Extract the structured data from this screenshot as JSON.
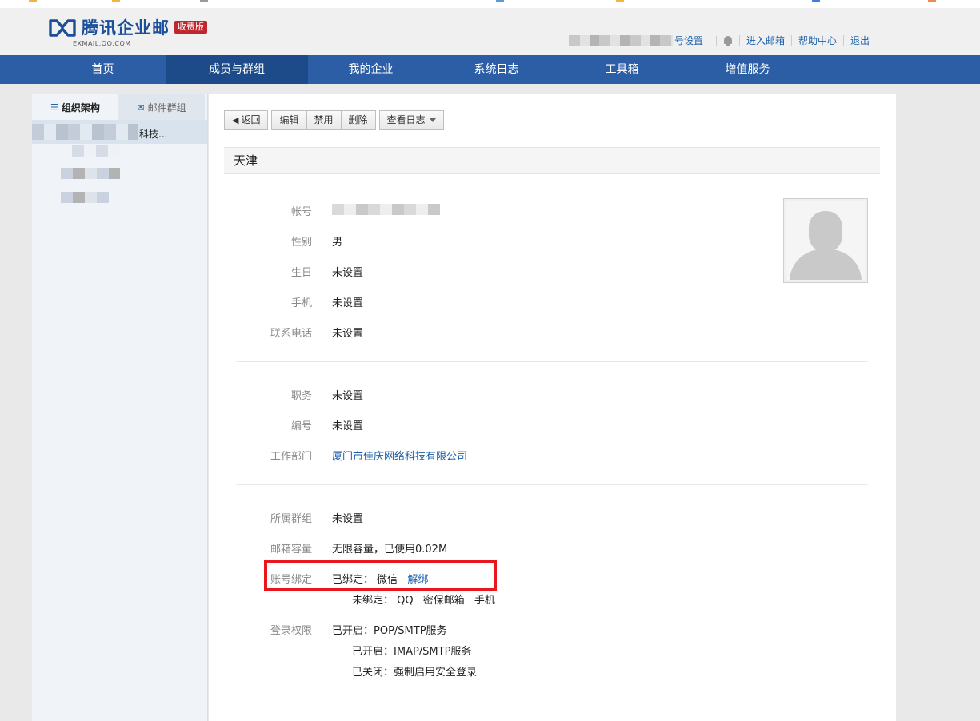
{
  "brand": {
    "name": "腾讯企业邮",
    "badge": "收费版",
    "domain": "EXMAIL.QQ.COM",
    "color": "#1b4f99"
  },
  "toplinks": {
    "account_settings": "号设置",
    "enter_mailbox": "进入邮箱",
    "help_center": "帮助中心",
    "logout": "退出"
  },
  "nav": {
    "tabs": [
      "首页",
      "成员与群组",
      "我的企业",
      "系统日志",
      "工具箱",
      "增值服务"
    ],
    "active_index": 1,
    "color": "#2c5ea5"
  },
  "sidebar": {
    "tab_org": "组织架构",
    "tab_groups": "邮件群组",
    "root_suffix": "科技..."
  },
  "toolbar": {
    "back": "返回",
    "edit": "编辑",
    "disable": "禁用",
    "delete": "删除",
    "view_log": "查看日志"
  },
  "member": {
    "name": "天津",
    "fields": {
      "account_label": "帐号",
      "gender_label": "性别",
      "gender": "男",
      "birthday_label": "生日",
      "birthday": "未设置",
      "mobile_label": "手机",
      "mobile": "未设置",
      "phone_label": "联系电话",
      "phone": "未设置",
      "title_label": "职务",
      "title": "未设置",
      "number_label": "编号",
      "number": "未设置",
      "dept_label": "工作部门",
      "dept": "厦门市佳庆网络科技有限公司",
      "group_label": "所属群组",
      "group": "未设置",
      "quota_label": "邮箱容量",
      "quota": "无限容量，已使用0.02M",
      "binding_label": "账号绑定",
      "bound_prefix": "已绑定：",
      "bound_items": "微信",
      "unbind": "解绑",
      "unbound_prefix": "未绑定：",
      "unbound_items": [
        "QQ",
        "密保邮箱",
        "手机"
      ],
      "login_label": "登录权限",
      "login_items": [
        {
          "state": "已开启：",
          "service": "POP/SMTP服务"
        },
        {
          "state": "已开启：",
          "service": "IMAP/SMTP服务"
        },
        {
          "state": "已关闭：",
          "service": "强制启用安全登录"
        }
      ]
    }
  },
  "colors": {
    "link": "#1b5fa8",
    "highlight": "#e8161e"
  }
}
